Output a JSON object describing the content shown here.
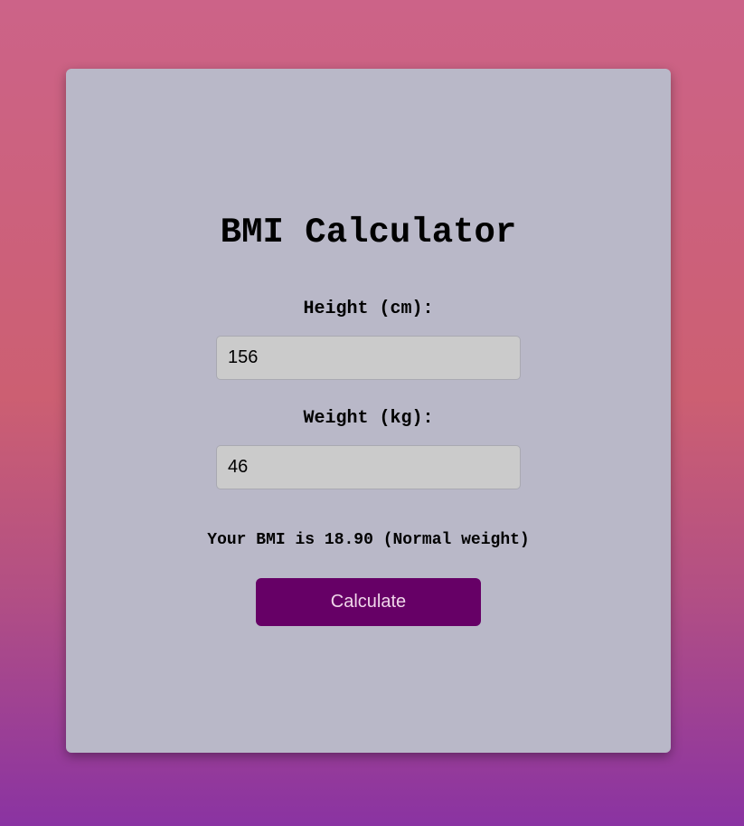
{
  "calculator": {
    "title": "BMI Calculator",
    "height": {
      "label": "Height (cm):",
      "value": "156"
    },
    "weight": {
      "label": "Weight (kg):",
      "value": "46"
    },
    "result": "Your BMI is 18.90 (Normal weight)",
    "button_label": "Calculate"
  },
  "colors": {
    "card_background": "#b9b8c8",
    "button_background": "#660066",
    "input_background": "#cbcbcb"
  }
}
